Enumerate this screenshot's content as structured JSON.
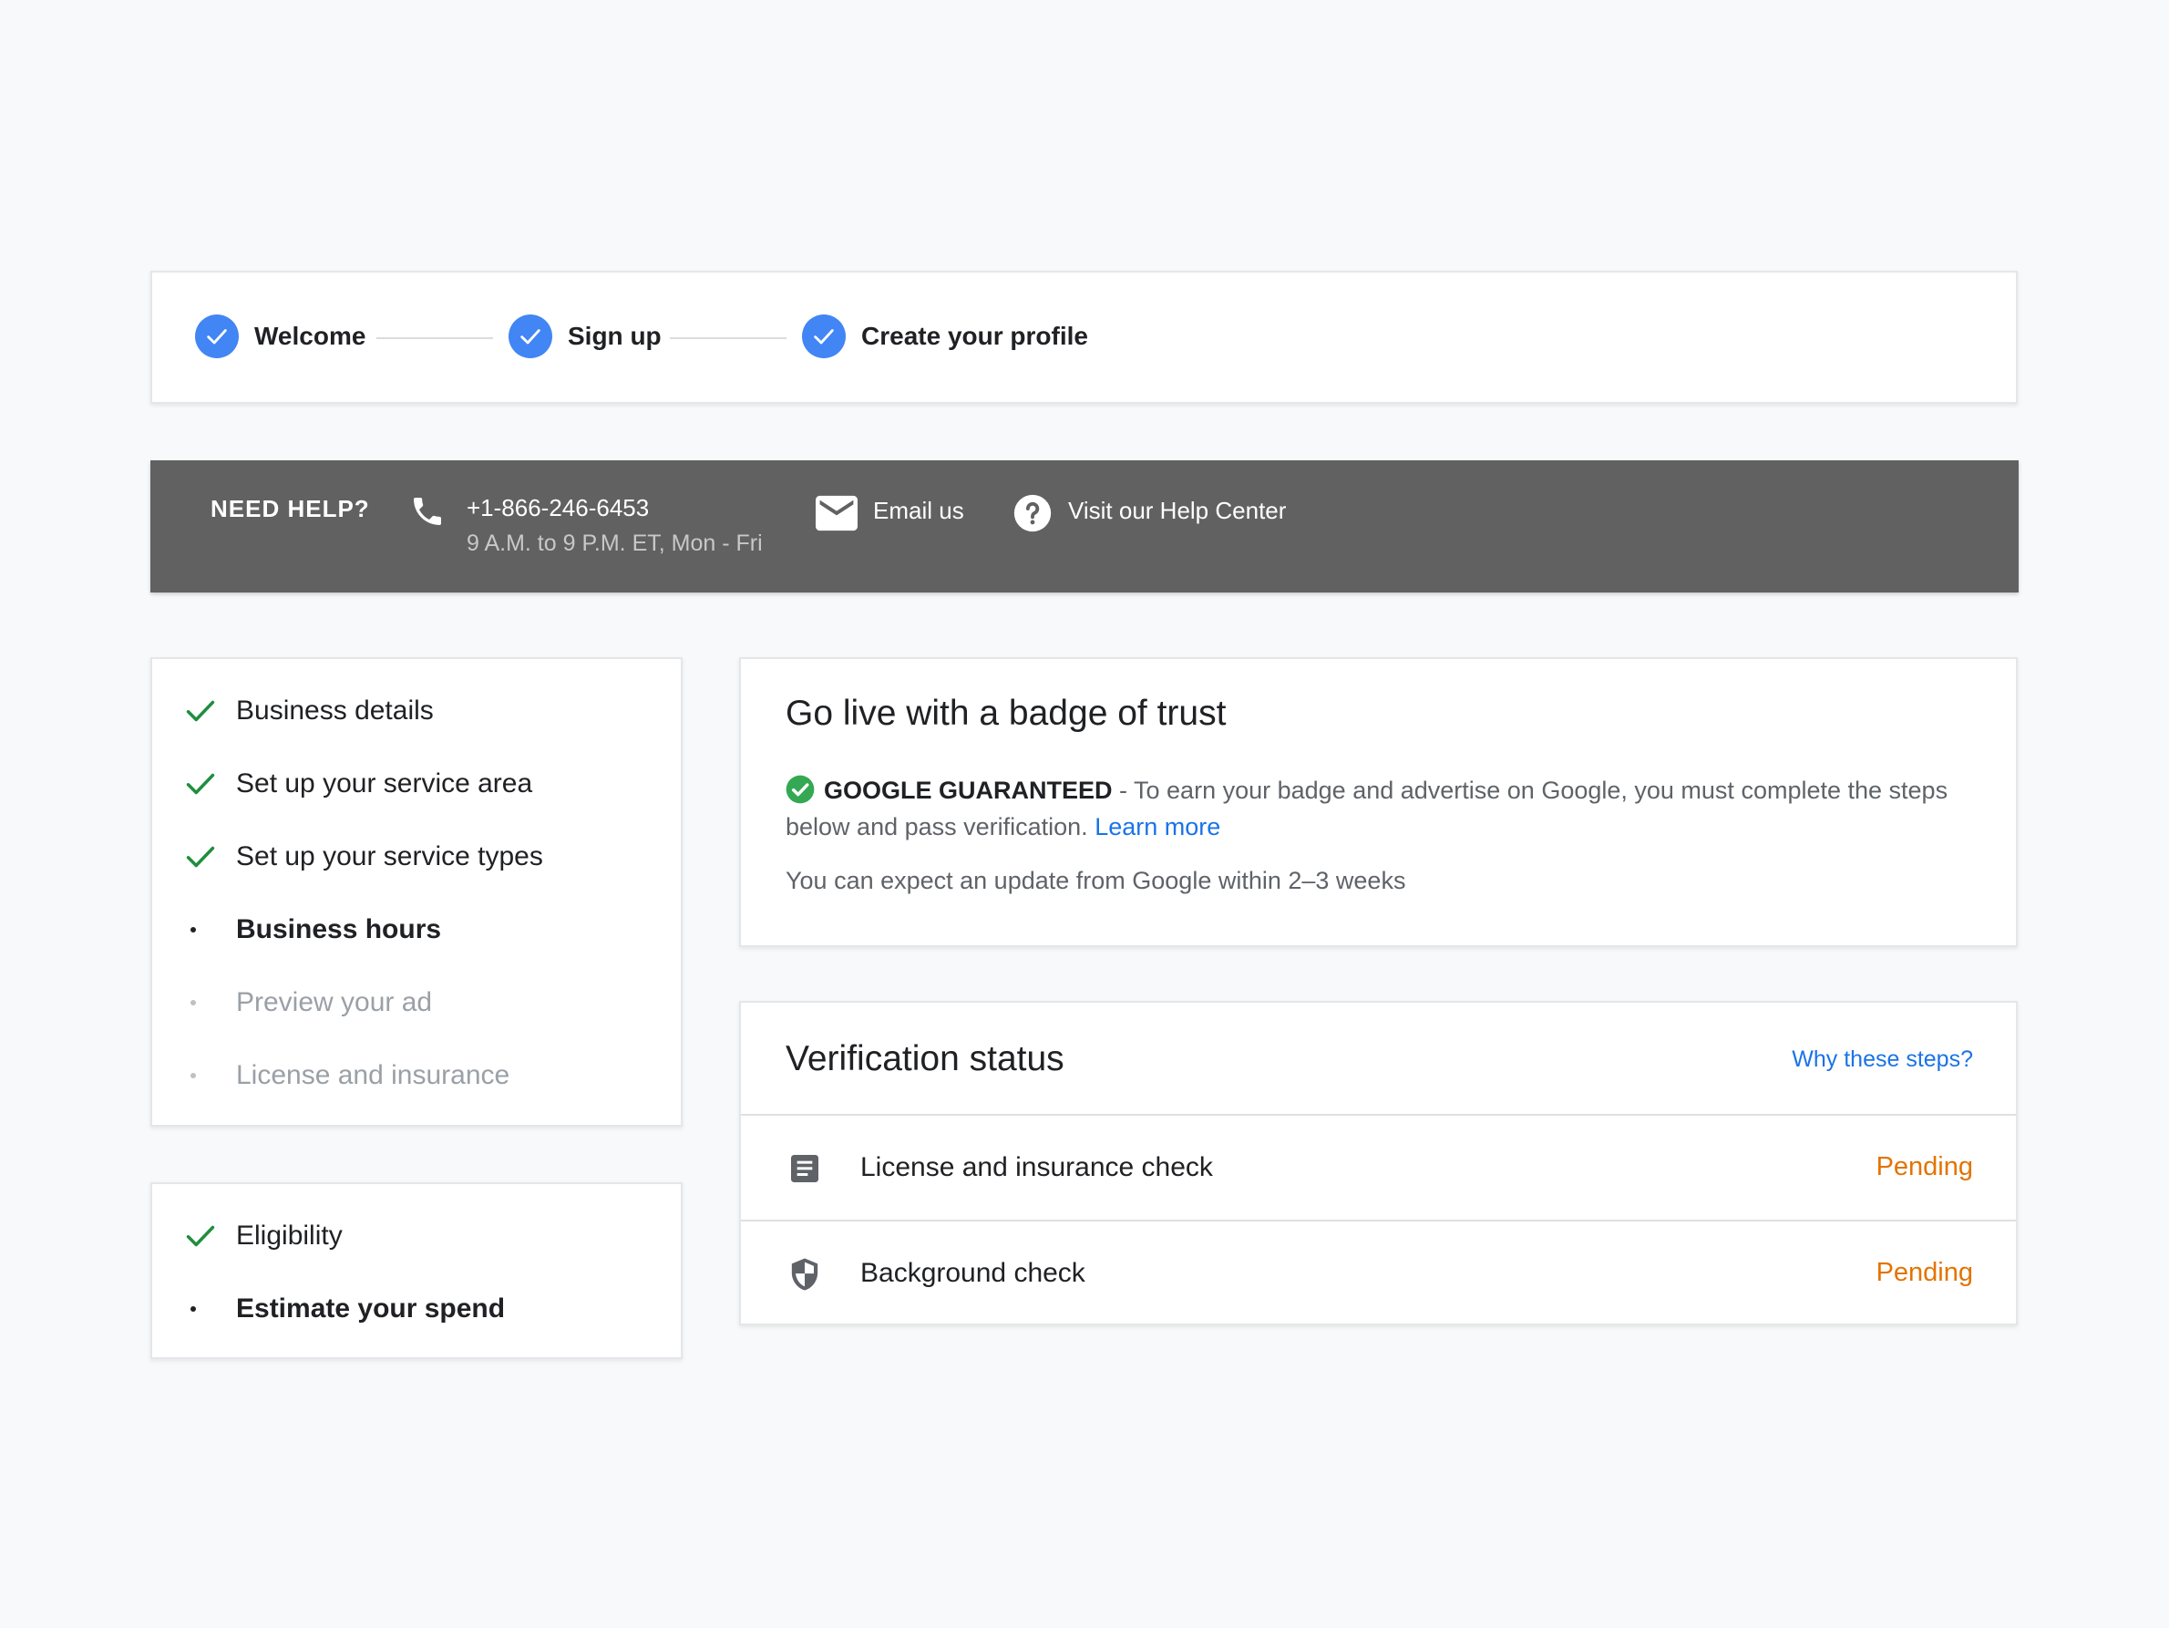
{
  "stepper": {
    "steps": [
      {
        "label": "Welcome",
        "state": "complete"
      },
      {
        "label": "Sign up",
        "state": "complete"
      },
      {
        "label": "Create your profile",
        "state": "complete"
      }
    ],
    "check_color": "#4285f4"
  },
  "help": {
    "title": "NEED HELP?",
    "phone": "+1-866-246-6453",
    "hours": "9 A.M. to 9 P.M. ET, Mon - Fri",
    "email_label": "Email us",
    "help_center_label": "Visit our Help Center",
    "background": "#616161",
    "icons": [
      "phone-icon",
      "mail-icon",
      "help-circle-icon"
    ]
  },
  "checklist_main": {
    "items": [
      {
        "label": "Business details",
        "state": "done"
      },
      {
        "label": "Set up your service area",
        "state": "done"
      },
      {
        "label": "Set up your service types",
        "state": "done"
      },
      {
        "label": "Business hours",
        "state": "current"
      },
      {
        "label": "Preview your ad",
        "state": "upcoming"
      },
      {
        "label": "License and insurance",
        "state": "upcoming"
      }
    ]
  },
  "checklist_spend": {
    "items": [
      {
        "label": "Eligibility",
        "state": "done"
      },
      {
        "label": "Estimate your spend",
        "state": "current"
      }
    ]
  },
  "badge": {
    "title": "Go live with a badge of trust",
    "guarantee_name": "GOOGLE GUARANTEED",
    "description": " - To earn your badge and advertise on Google, you must complete the steps below and pass verification. ",
    "learn_more": "Learn more",
    "update_note": "You can expect an update from Google within 2–3 weeks"
  },
  "verification": {
    "title": "Verification status",
    "why_link": "Why these steps?",
    "rows": [
      {
        "label": "License and insurance check",
        "status": "Pending",
        "icon": "document-icon"
      },
      {
        "label": "Background check",
        "status": "Pending",
        "icon": "shield-icon"
      }
    ],
    "pending_color": "#e37400"
  },
  "colors": {
    "accent_blue": "#4285f4",
    "link_blue": "#1a73e8",
    "success_green": "#1e8e3e",
    "pending_orange": "#e37400"
  }
}
